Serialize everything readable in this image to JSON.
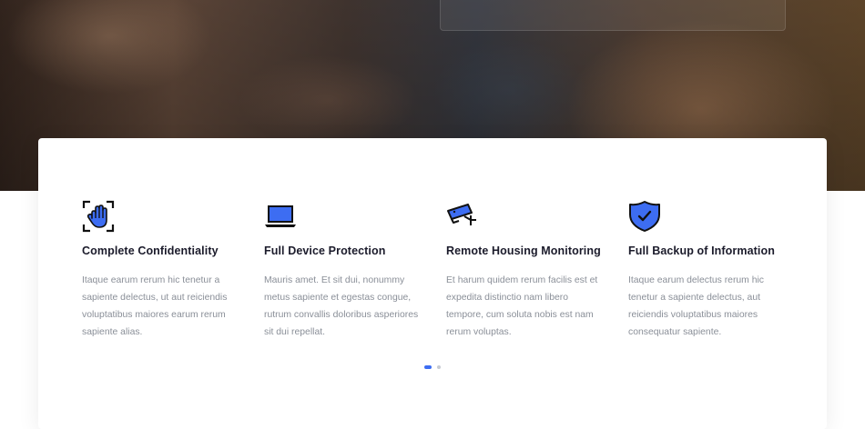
{
  "features": [
    {
      "icon": "hand-scan-icon",
      "title": "Complete Confidentiality",
      "description": "Itaque earum rerum hic tenetur a sapiente delectus, ut aut reiciendis voluptatibus maiores earum rerum sapiente alias."
    },
    {
      "icon": "laptop-icon",
      "title": "Full Device Protection",
      "description": "Mauris amet. Et sit dui, nonummy metus sapiente et egestas congue, rutrum convallis doloribus asperiores sit dui repellat."
    },
    {
      "icon": "security-camera-icon",
      "title": "Remote Housing Monitoring",
      "description": "Et harum quidem rerum facilis est et expedita distinctio nam libero tempore, cum soluta nobis est nam rerum voluptas."
    },
    {
      "icon": "shield-check-icon",
      "title": "Full Backup of Information",
      "description": "Itaque earum delectus rerum hic tenetur a sapiente delectus, aut reiciendis voluptatibus maiores consequatur sapiente."
    }
  ],
  "carousel": {
    "pages": 2,
    "active": 1
  },
  "colors": {
    "accent": "#3d6df2",
    "icon_fill": "#3d6df2",
    "icon_stroke": "#111111",
    "title": "#1b1b2b",
    "text": "#8a8f98"
  }
}
